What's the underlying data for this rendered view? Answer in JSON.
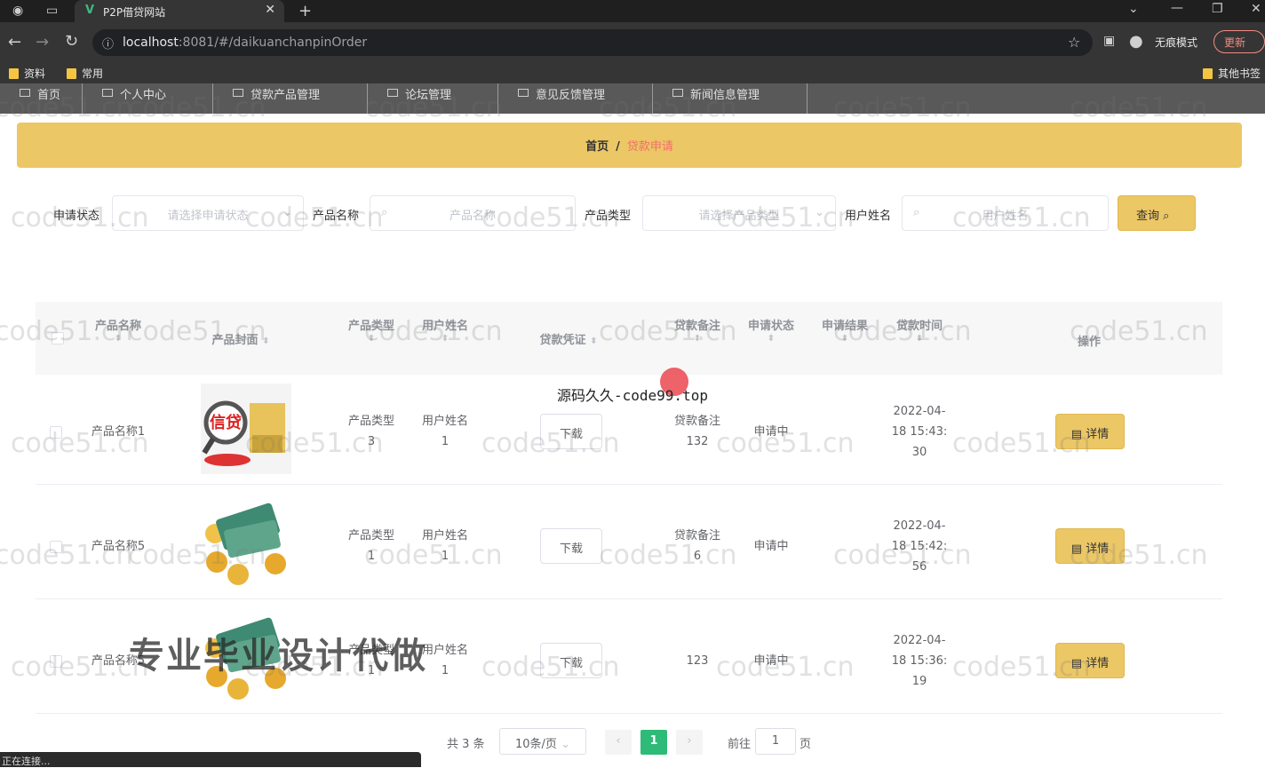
{
  "browser": {
    "tab_title": "P2P借贷网站",
    "url_host": "localhost",
    "url_rest": ":8081/#/daikuanchanpinOrder",
    "incognito_label": "无痕模式",
    "update_label": "更新",
    "bookmarks": [
      "资料",
      "常用"
    ],
    "other_bookmarks": "其他书签",
    "status_text": "正在连接..."
  },
  "nav": {
    "items": [
      "首页",
      "个人中心",
      "贷款产品管理",
      "论坛管理",
      "意见反馈管理",
      "新闻信息管理"
    ]
  },
  "breadcrumb": {
    "home": "首页",
    "separator": "/",
    "current": "贷款申请"
  },
  "filters": {
    "status_label": "申请状态",
    "status_placeholder": "请选择申请状态",
    "product_name_label": "产品名称",
    "product_name_placeholder": "产品名称",
    "product_type_label": "产品类型",
    "product_type_placeholder": "请选择产品类型",
    "username_label": "用户姓名",
    "username_placeholder": "用户姓名",
    "query_label": "查询"
  },
  "table": {
    "headers": {
      "name": "产品名称",
      "cover": "产品封面",
      "type": "产品类型",
      "user": "用户姓名",
      "voucher": "贷款凭证",
      "remark": "贷款备注",
      "status": "申请状态",
      "result": "申请结果",
      "time": "贷款时间",
      "action": "操作"
    },
    "rows": [
      {
        "name": "产品名称1",
        "type_line1": "产品类型",
        "type_line2": "3",
        "user_line1": "用户姓名",
        "user_line2": "1",
        "download": "下载",
        "remark_line1": "贷款备注",
        "remark_line2": "132",
        "status": "申请中",
        "time_line1": "2022-04-",
        "time_line2": "18 15:43:",
        "time_line3": "30",
        "detail": "详情",
        "cover_text": "信贷"
      },
      {
        "name": "产品名称5",
        "type_line1": "产品类型",
        "type_line2": "1",
        "user_line1": "用户姓名",
        "user_line2": "1",
        "download": "下载",
        "remark_line1": "贷款备注",
        "remark_line2": "6",
        "status": "申请中",
        "time_line1": "2022-04-",
        "time_line2": "18 15:42:",
        "time_line3": "56",
        "detail": "详情"
      },
      {
        "name": "产品名称5",
        "type_line1": "产品类型",
        "type_line2": "1",
        "user_line1": "用户姓名",
        "user_line2": "1",
        "download": "下载",
        "remark_line1": "123",
        "remark_line2": "",
        "status": "申请中",
        "time_line1": "2022-04-",
        "time_line2": "18 15:36:",
        "time_line3": "19",
        "detail": "详情"
      }
    ]
  },
  "pagination": {
    "total": "共 3 条",
    "page_size": "10条/页",
    "current_page": "1",
    "goto_label": "前往",
    "goto_value": "1",
    "page_unit": "页"
  },
  "overlays": {
    "watermark": "code51.cn",
    "source_text": "源码久久-code99.top",
    "promo": "专业毕业设计代做"
  },
  "colors": {
    "accent": "#ecc766",
    "active_page": "#2dbb77",
    "breadcrumb_current": "#f56c6c",
    "nav_bg": "#595959"
  }
}
